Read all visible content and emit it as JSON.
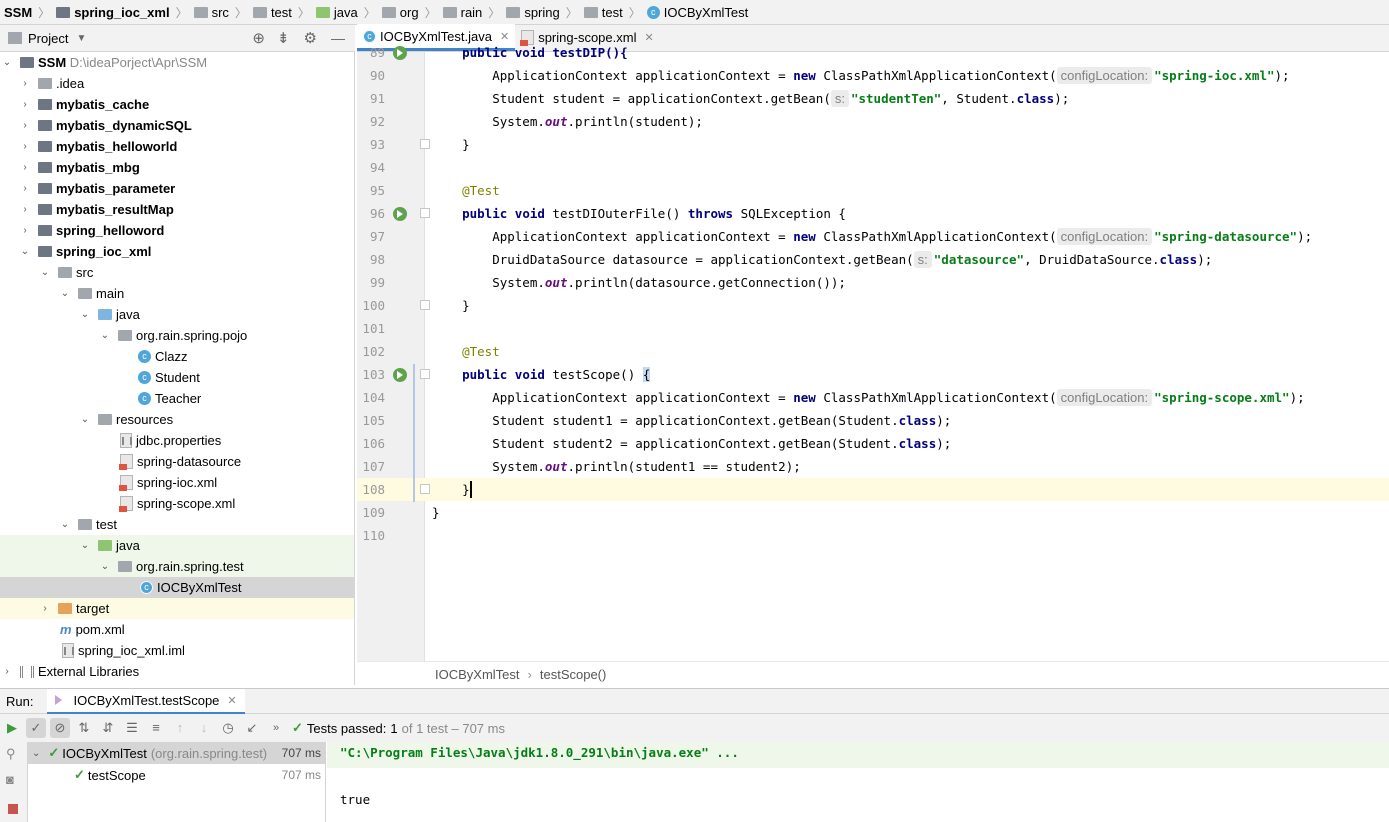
{
  "breadcrumb": {
    "items": [
      "SSM",
      "spring_ioc_xml",
      "src",
      "test",
      "java",
      "org",
      "rain",
      "spring",
      "test",
      "IOCByXmlTest"
    ]
  },
  "project_panel": {
    "title": "Project",
    "tree": [
      {
        "label": "SSM",
        "suffix": "D:\\ideaPorject\\Apr\\SSM",
        "bold": true
      },
      {
        "label": ".idea"
      },
      {
        "label": "mybatis_cache",
        "bold": true
      },
      {
        "label": "mybatis_dynamicSQL",
        "bold": true
      },
      {
        "label": "mybatis_helloworld",
        "bold": true
      },
      {
        "label": "mybatis_mbg",
        "bold": true
      },
      {
        "label": "mybatis_parameter",
        "bold": true
      },
      {
        "label": "mybatis_resultMap",
        "bold": true
      },
      {
        "label": "spring_helloword",
        "bold": true
      },
      {
        "label": "spring_ioc_xml",
        "bold": true
      },
      {
        "label": "src"
      },
      {
        "label": "main"
      },
      {
        "label": "java"
      },
      {
        "label": "org.rain.spring.pojo"
      },
      {
        "label": "Clazz"
      },
      {
        "label": "Student"
      },
      {
        "label": "Teacher"
      },
      {
        "label": "resources"
      },
      {
        "label": "jdbc.properties"
      },
      {
        "label": "spring-datasource"
      },
      {
        "label": "spring-ioc.xml"
      },
      {
        "label": "spring-scope.xml"
      },
      {
        "label": "test"
      },
      {
        "label": "java"
      },
      {
        "label": "org.rain.spring.test"
      },
      {
        "label": "IOCByXmlTest"
      },
      {
        "label": "target"
      },
      {
        "label": "pom.xml"
      },
      {
        "label": "spring_ioc_xml.iml"
      },
      {
        "label": "External Libraries"
      }
    ]
  },
  "editor": {
    "tabs": [
      {
        "label": "IOCByXmlTest.java",
        "active": true
      },
      {
        "label": "spring-scope.xml",
        "active": false
      }
    ],
    "line_numbers": [
      "89",
      "90",
      "91",
      "92",
      "93",
      "94",
      "95",
      "96",
      "97",
      "98",
      "99",
      "100",
      "101",
      "102",
      "103",
      "104",
      "105",
      "106",
      "107",
      "108",
      "109",
      "110"
    ],
    "hint_config": "configLocation:",
    "hint_s": "s:",
    "tokens": {
      "l89a": "    public void testDIP(){",
      "l90a": "        ApplicationContext applicationContext = ",
      "l90b": "new",
      "l90c": " ClassPathXmlApplicationContext(",
      "l90d": "\"spring-ioc.xml\"",
      "l90e": ");",
      "l91a": "        Student student = applicationContext.getBean(",
      "l91b": "\"studentTen\"",
      "l91c": ", Student.",
      "l91d": "class",
      "l91e": ");",
      "l92a": "        System.",
      "l92b": "out",
      "l92c": ".println(student);",
      "l93": "    }",
      "l95": "    @Test",
      "l96a": "public void",
      "l96b": " testDIOuterFile() ",
      "l96c": "throws",
      "l96d": " SQLException {",
      "l97a": "        ApplicationContext applicationContext = ",
      "l97b": "new",
      "l97c": " ClassPathXmlApplicationContext(",
      "l97d": "\"spring-datasource\"",
      "l97e": ");",
      "l98a": "        DruidDataSource datasource = applicationContext.getBean(",
      "l98b": "\"datasource\"",
      "l98c": ", DruidDataSource.",
      "l98d": "class",
      "l98e": ");",
      "l99a": "        System.",
      "l99b": "out",
      "l99c": ".println(datasource.getConnection());",
      "l100": "    }",
      "l102": "    @Test",
      "l103a": "public void",
      "l103b": " testScope() ",
      "l103c": "{",
      "l104a": "        ApplicationContext applicationContext = ",
      "l104b": "new",
      "l104c": " ClassPathXmlApplicationContext(",
      "l104d": "\"spring-scope.xml\"",
      "l104e": ");",
      "l105a": "        Student student1 = applicationContext.getBean(Student.",
      "l105b": "class",
      "l105c": ");",
      "l106a": "        Student student2 = applicationContext.getBean(Student.",
      "l106b": "class",
      "l106c": ");",
      "l107a": "        System.",
      "l107b": "out",
      "l107c": ".println(student1 == student2);",
      "l108": "    }",
      "l109": "}"
    },
    "breadcrumb": [
      "IOCByXmlTest",
      "testScope()"
    ]
  },
  "run": {
    "label": "Run:",
    "tab": "IOCByXmlTest.testScope",
    "status_prefix": "Tests passed:",
    "status_count": "1",
    "status_rest": "of 1 test – 707 ms",
    "tree": [
      {
        "label": "IOCByXmlTest",
        "pkg": "(org.rain.spring.test)",
        "time": "707 ms"
      },
      {
        "label": "testScope",
        "time": "707 ms"
      }
    ],
    "console": [
      "\"C:\\Program Files\\Java\\jdk1.8.0_291\\bin\\java.exe\" ...",
      "true"
    ]
  },
  "colors": {
    "keyword": "#000080",
    "string": "#067d17",
    "annotation": "#808000",
    "static_field": "#660e7a",
    "pass_green": "#3d9a3d"
  }
}
